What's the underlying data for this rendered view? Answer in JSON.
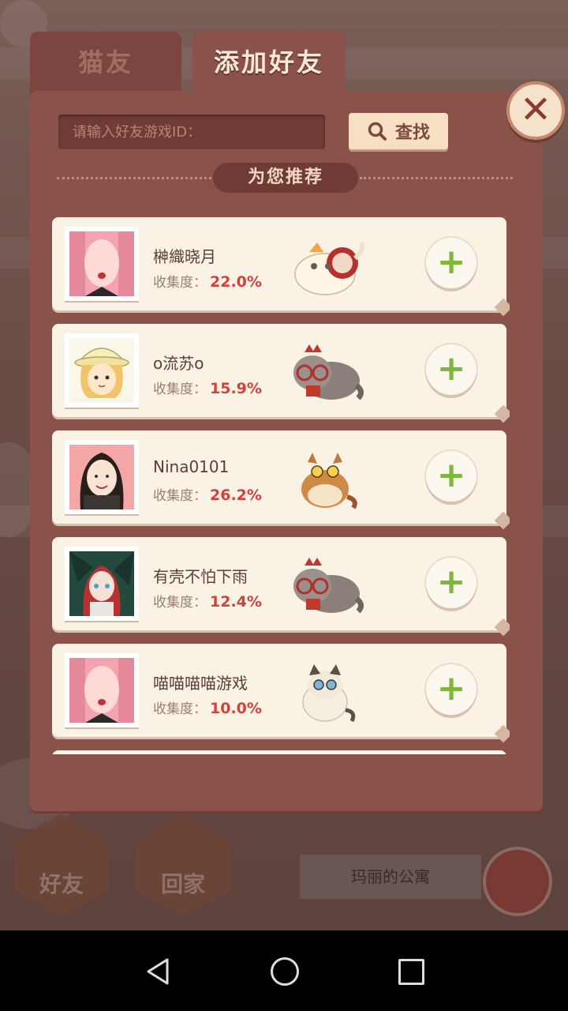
{
  "tabs": {
    "cat_friends": "猫友",
    "add_friend": "添加好友"
  },
  "close_icon": "close-icon",
  "search": {
    "placeholder": "请输入好友游戏ID：",
    "value": "",
    "button_label": "查找"
  },
  "recommend_title": "为您推荐",
  "collect_label": "收集度：",
  "friends": [
    {
      "name": "榊織晓月",
      "collect": "22.0%",
      "cat": "white-cat-bonnet"
    },
    {
      "name": "o流苏o",
      "collect": "15.9%",
      "cat": "gray-cat-glasses"
    },
    {
      "name": "Nina0101",
      "collect": "26.2%",
      "cat": "orange-cat"
    },
    {
      "name": "有壳不怕下雨",
      "collect": "12.4%",
      "cat": "gray-cat-glasses"
    },
    {
      "name": "喵喵喵喵游戏",
      "collect": "10.0%",
      "cat": "siamese-cat"
    }
  ],
  "background": {
    "nav_friends": "好友",
    "nav_home": "回家",
    "apartment_label": "玛丽的公寓"
  },
  "colors": {
    "accent": "#8a5249",
    "plus": "#7cb83a",
    "percent": "#d0423a"
  }
}
